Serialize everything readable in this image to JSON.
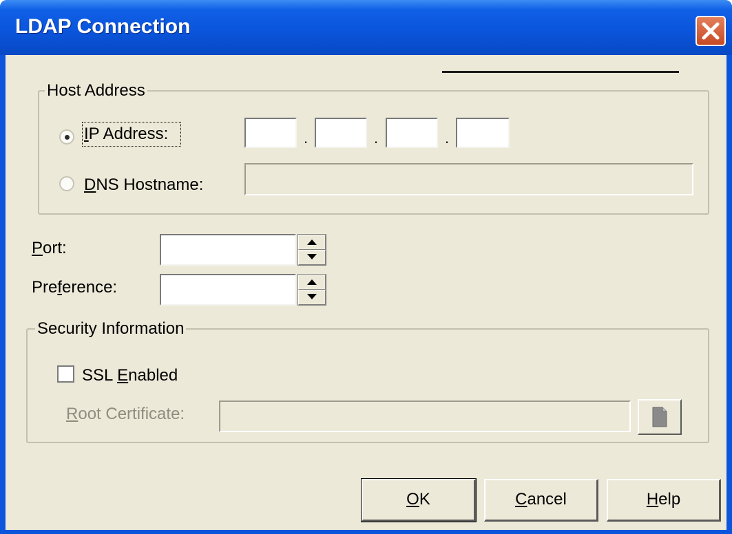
{
  "window": {
    "title": "LDAP Connection",
    "close_icon": "close-icon"
  },
  "host_address": {
    "group_label": "Host Address",
    "ip_option": {
      "label_pre": "",
      "label_mnemonic": "I",
      "label_post": "P Address:",
      "selected": true
    },
    "ip_octets": [
      "",
      "",
      "",
      ""
    ],
    "dns_option": {
      "label_pre": "",
      "label_mnemonic": "D",
      "label_post": "NS Hostname:",
      "selected": false
    },
    "dns_value": ""
  },
  "port": {
    "label_pre": "",
    "label_mnemonic": "P",
    "label_post": "ort:",
    "value": ""
  },
  "preference": {
    "label_pre": "Pre",
    "label_mnemonic": "f",
    "label_post": "erence:",
    "value": ""
  },
  "security": {
    "group_label": "Security Information",
    "ssl": {
      "label_pre": "SSL ",
      "label_mnemonic": "E",
      "label_post": "nabled",
      "checked": false
    },
    "root_cert": {
      "label_pre": "",
      "label_mnemonic": "R",
      "label_post": "oot Certificate:",
      "value": "",
      "browse_icon": "document-icon"
    }
  },
  "buttons": {
    "ok": {
      "label_pre": "",
      "label_mnemonic": "O",
      "label_post": "K"
    },
    "cancel": {
      "label_pre": "",
      "label_mnemonic": "C",
      "label_post": "ancel"
    },
    "help": {
      "label_pre": "",
      "label_mnemonic": "H",
      "label_post": "elp"
    }
  },
  "colors": {
    "title_bar": "#0a55dc",
    "dialog_bg": "#ece9d8",
    "close_button": "#d9603a"
  }
}
